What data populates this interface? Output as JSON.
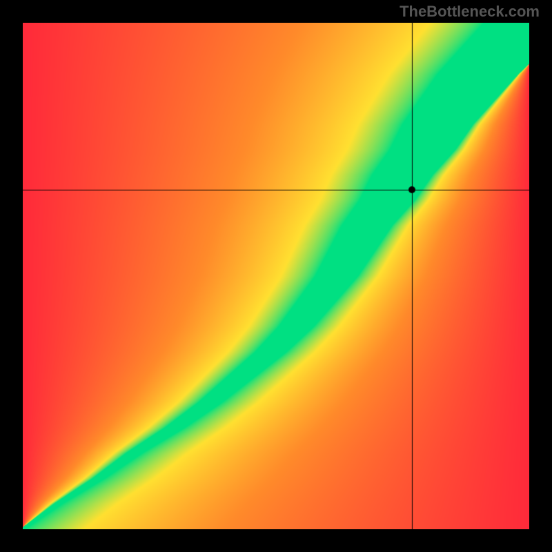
{
  "watermark": "TheBottleneck.com",
  "chart_data": {
    "type": "heatmap",
    "title": "",
    "xlabel": "",
    "ylabel": "",
    "xlim": [
      0,
      1
    ],
    "ylim": [
      0,
      1
    ],
    "crosshair": {
      "x": 0.77,
      "y": 0.67,
      "marker": true
    },
    "ridge_curve": {
      "description": "Approximate x (normalized 0-1) of green optimal band center as a function of y (0=bottom,1=top)",
      "points": [
        {
          "y": 0.0,
          "x": 0.0
        },
        {
          "y": 0.05,
          "x": 0.07
        },
        {
          "y": 0.1,
          "x": 0.15
        },
        {
          "y": 0.15,
          "x": 0.22
        },
        {
          "y": 0.2,
          "x": 0.3
        },
        {
          "y": 0.25,
          "x": 0.37
        },
        {
          "y": 0.3,
          "x": 0.43
        },
        {
          "y": 0.35,
          "x": 0.49
        },
        {
          "y": 0.4,
          "x": 0.54
        },
        {
          "y": 0.45,
          "x": 0.58
        },
        {
          "y": 0.5,
          "x": 0.62
        },
        {
          "y": 0.55,
          "x": 0.65
        },
        {
          "y": 0.6,
          "x": 0.68
        },
        {
          "y": 0.65,
          "x": 0.72
        },
        {
          "y": 0.7,
          "x": 0.75
        },
        {
          "y": 0.75,
          "x": 0.79
        },
        {
          "y": 0.8,
          "x": 0.82
        },
        {
          "y": 0.85,
          "x": 0.86
        },
        {
          "y": 0.9,
          "x": 0.9
        },
        {
          "y": 0.95,
          "x": 0.95
        },
        {
          "y": 1.0,
          "x": 1.0
        }
      ],
      "band_halfwidth_at_y": [
        {
          "y": 0.0,
          "hw": 0.005
        },
        {
          "y": 0.2,
          "hw": 0.02
        },
        {
          "y": 0.4,
          "hw": 0.035
        },
        {
          "y": 0.6,
          "hw": 0.05
        },
        {
          "y": 0.8,
          "hw": 0.07
        },
        {
          "y": 1.0,
          "hw": 0.09
        }
      ]
    },
    "corner_values": {
      "bottom_left": 0,
      "top_right": 0,
      "top_left": -1,
      "bottom_right": -1,
      "note": "0 along ridge = optimal (green); magnitude increases toward corners with sign indicating which component bottlenecks"
    },
    "color_scale": [
      {
        "value": -1.0,
        "color": "#ff2a3a"
      },
      {
        "value": -0.5,
        "color": "#ff8a2a"
      },
      {
        "value": -0.2,
        "color": "#ffe030"
      },
      {
        "value": 0.0,
        "color": "#00e082"
      },
      {
        "value": 0.2,
        "color": "#ffe030"
      },
      {
        "value": 0.5,
        "color": "#ff8a2a"
      },
      {
        "value": 1.0,
        "color": "#ff2a3a"
      }
    ]
  }
}
